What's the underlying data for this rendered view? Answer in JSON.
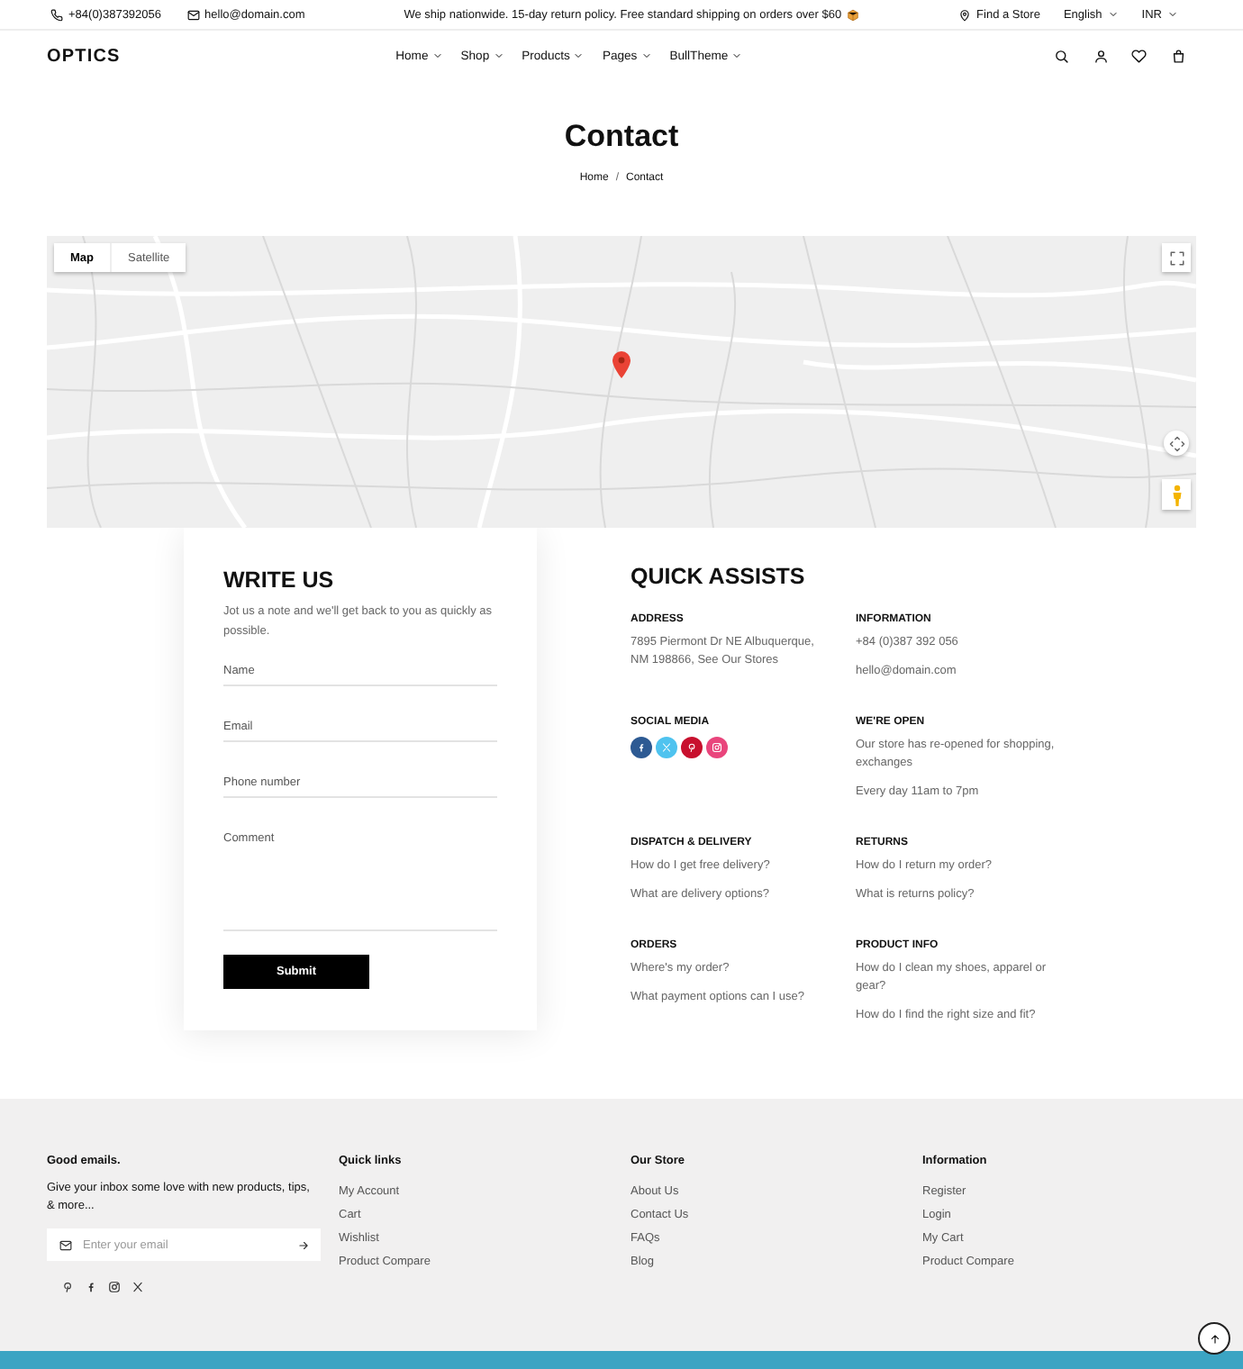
{
  "top_bar": {
    "phone": "+84(0)387392056",
    "email": "hello@domain.com",
    "announcement": "We ship nationwide. 15-day return policy. Free standard shipping on orders over $60",
    "store_link": "Find a Store",
    "language": "English",
    "currency": "INR"
  },
  "header": {
    "logo": "OPTICS",
    "menu": [
      {
        "label": "Home"
      },
      {
        "label": "Shop"
      },
      {
        "label": "Products"
      },
      {
        "label": "Pages"
      },
      {
        "label": "BullTheme"
      }
    ]
  },
  "page_title": "Contact",
  "breadcrumb": {
    "items": [
      "Home",
      "Contact"
    ],
    "separator": "/"
  },
  "map": {
    "map_types": [
      {
        "label": "Map",
        "selected": true
      },
      {
        "label": "Satellite",
        "selected": false
      }
    ]
  },
  "write_us": {
    "title": "WRITE US",
    "description": "Jot us a note and we'll get back to you as quickly as possible.",
    "fields": [
      {
        "kind": "input",
        "placeholder": "Name"
      },
      {
        "kind": "input",
        "placeholder": "Email"
      },
      {
        "kind": "input",
        "placeholder": "Phone number"
      },
      {
        "kind": "textarea",
        "placeholder": "Comment"
      }
    ],
    "submit": "Submit"
  },
  "quick_assists": {
    "title": "QUICK ASSISTS",
    "sections": [
      {
        "heading": "ADDRESS",
        "kind": "text",
        "lines": [
          "7895 Piermont Dr NE Albuquerque, NM 198866, See Our Stores"
        ]
      },
      {
        "heading": "INFORMATION",
        "kind": "text",
        "lines": [
          "+84 (0)387 392 056",
          "hello@domain.com"
        ]
      },
      {
        "heading": "SOCIAL MEDIA",
        "kind": "social",
        "icons": [
          {
            "kind": "facebook",
            "color": "#2d5a93"
          },
          {
            "kind": "x",
            "color": "#4fc3ef"
          },
          {
            "kind": "pinterest",
            "color": "#c8102e"
          },
          {
            "kind": "instagram",
            "color": "#e9457c"
          }
        ]
      },
      {
        "heading": "WE'RE OPEN",
        "kind": "text",
        "lines": [
          "Our store has re-opened for shopping, exchanges",
          "Every day 11am to 7pm"
        ]
      },
      {
        "heading": "DISPATCH & DELIVERY",
        "kind": "links",
        "lines": [
          "How do I get free delivery?",
          "What are delivery options?"
        ]
      },
      {
        "heading": "RETURNS",
        "kind": "links",
        "lines": [
          "How do I return my order?",
          "What is returns policy?"
        ]
      },
      {
        "heading": "ORDERS",
        "kind": "links",
        "lines": [
          "Where's my order?",
          "What payment options can I use?"
        ]
      },
      {
        "heading": "PRODUCT INFO",
        "kind": "links",
        "lines": [
          "How do I clean my shoes, apparel or gear?",
          "How do I find the right size and fit?"
        ]
      }
    ]
  },
  "footer": {
    "newsletter": {
      "heading": "Good emails.",
      "text": "Give your inbox some love with new products, tips, & more...",
      "placeholder": "Enter your email"
    },
    "social": [
      {
        "kind": "pinterest"
      },
      {
        "kind": "facebook"
      },
      {
        "kind": "instagram"
      },
      {
        "kind": "x"
      }
    ],
    "columns": [
      {
        "heading": "Quick links",
        "links": [
          "My Account",
          "Cart",
          "Wishlist",
          "Product Compare"
        ]
      },
      {
        "heading": "Our Store",
        "links": [
          "About Us",
          "Contact Us",
          "FAQs",
          "Blog"
        ]
      },
      {
        "heading": "Information",
        "links": [
          "Register",
          "Login",
          "My Cart",
          "Product Compare"
        ]
      }
    ]
  }
}
